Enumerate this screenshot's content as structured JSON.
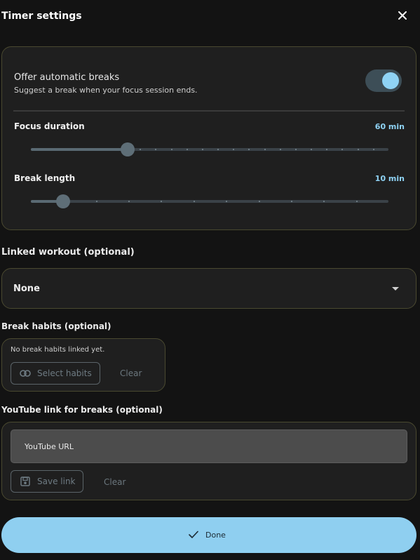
{
  "dialog": {
    "title": "Timer settings"
  },
  "timer": {
    "auto_breaks": {
      "title": "Offer automatic breaks",
      "description": "Suggest a break when your focus session ends.",
      "enabled": true
    },
    "focus": {
      "label": "Focus duration",
      "value_text": "60 min",
      "fraction": 0.27
    },
    "break": {
      "label": "Break length",
      "value_text": "10 min",
      "fraction": 0.09
    }
  },
  "workout": {
    "label": "Linked workout (optional)",
    "selected": "None"
  },
  "habits": {
    "label": "Break habits (optional)",
    "empty_text": "No break habits linked yet.",
    "select_label": "Select habits",
    "clear_label": "Clear"
  },
  "youtube": {
    "label": "YouTube link for breaks (optional)",
    "placeholder": "YouTube URL",
    "save_label": "Save link",
    "clear_label": "Clear"
  },
  "footer": {
    "done_label": "Done"
  },
  "colors": {
    "accent": "#8fd3f5",
    "background": "#131313",
    "card": "#1f1f1f",
    "card_border": "#4a4930"
  }
}
